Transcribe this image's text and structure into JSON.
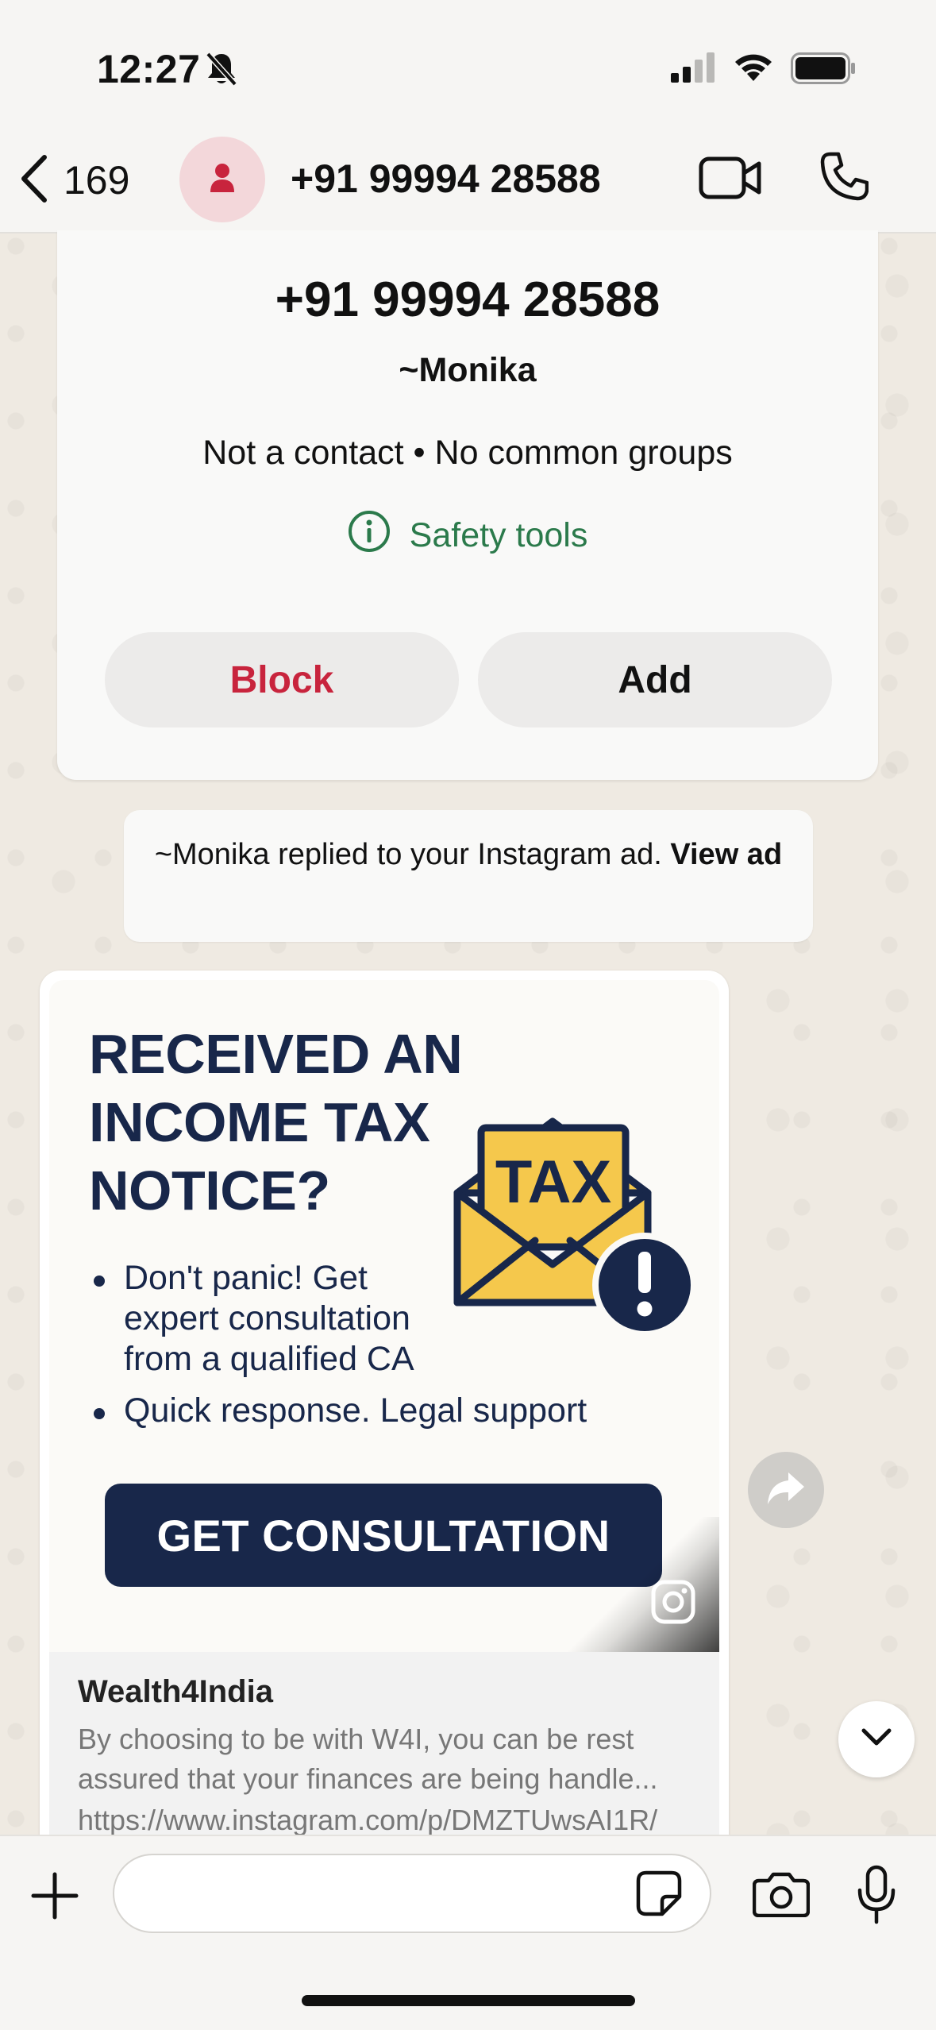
{
  "status_bar": {
    "time": "12:27",
    "icons": [
      "bell-slash-icon",
      "cellular-signal-icon",
      "wifi-icon",
      "battery-icon"
    ]
  },
  "header": {
    "back_count": "169",
    "title": "+91 99994 28588",
    "icons": [
      "chevron-left-icon",
      "person-icon",
      "video-camera-icon",
      "phone-icon"
    ],
    "avatar_bg": "#f3d7da",
    "avatar_icon_color": "#c8243d"
  },
  "contact_card": {
    "phone": "+91 99994 28588",
    "name": "~Monika",
    "meta": "Not a contact • No common groups",
    "safety_tools_label": "Safety tools",
    "block_label": "Block",
    "add_label": "Add",
    "block_color": "#c8243d",
    "safety_color": "#2b7a4b"
  },
  "system_notice": {
    "text": "~Monika replied to your Instagram ad. ",
    "link_label": "View ad"
  },
  "ad_message": {
    "headline": "RECEIVED AN INCOME TAX NOTICE?",
    "bullets": [
      "Don't panic! Get expert consultation from a qualified CA",
      "Quick response. Legal support"
    ],
    "cta_label": "GET CONSULTATION",
    "envelope_text": "TAX",
    "brand": "Wealth4India",
    "description": "By choosing to be with W4I, you can be rest assured that your finances are being handle...",
    "url": "https://www.instagram.com/p/DMZTUwsAI1R/",
    "colors": {
      "navy": "#18274a",
      "envelope_yellow": "#f5c84c"
    }
  },
  "composer": {
    "input_value": "",
    "input_placeholder": "",
    "icons": [
      "plus-icon",
      "sticker-icon",
      "camera-icon",
      "microphone-icon"
    ]
  },
  "floating": {
    "icons": [
      "forward-icon",
      "chevron-down-icon"
    ]
  }
}
